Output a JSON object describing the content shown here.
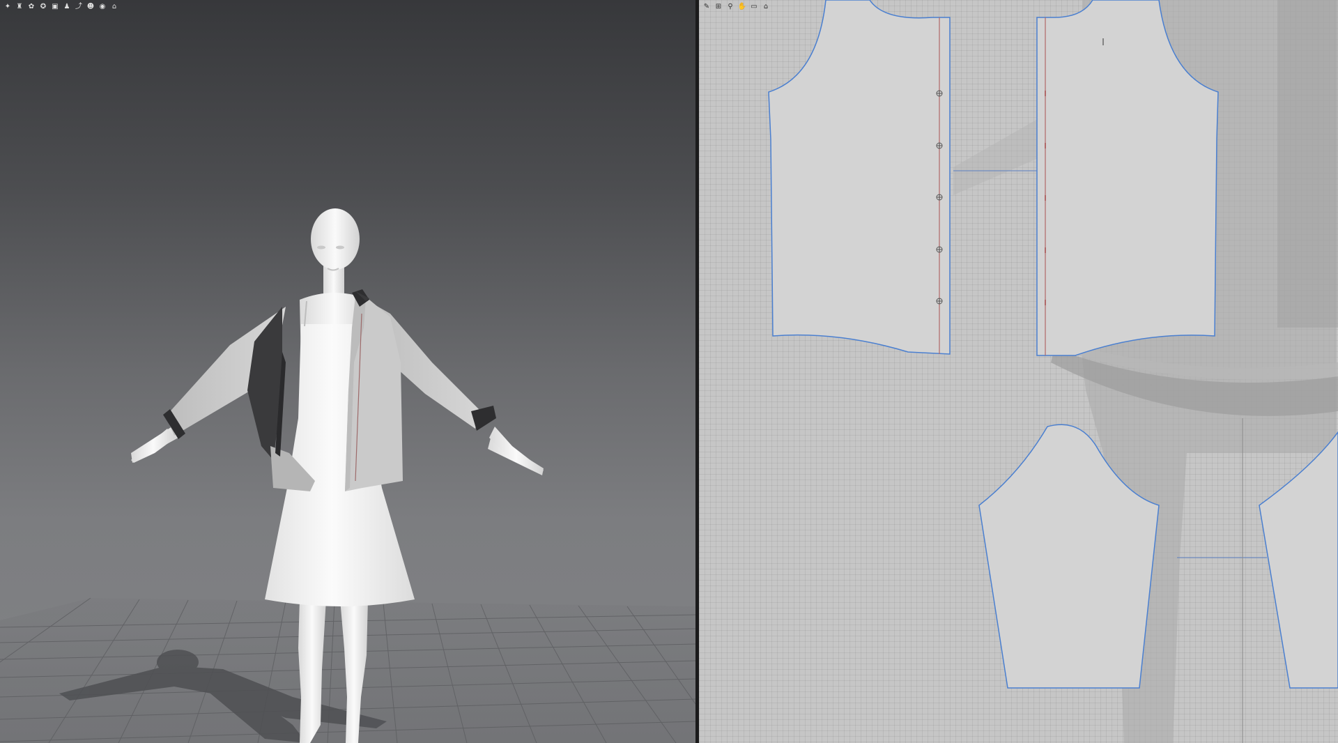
{
  "toolbar_3d": {
    "icons": [
      "simulation-icon",
      "garment-icon",
      "fabric-icon",
      "style-icon",
      "texture-icon",
      "avatar-icon",
      "pose-icon",
      "measure-icon",
      "render-icon"
    ]
  },
  "toolbar_2d": {
    "icons": [
      "edit-pattern-icon",
      "transform-icon",
      "zoom-icon",
      "hand-icon",
      "layer-icon",
      "render-icon"
    ]
  },
  "viewport_3d": {
    "background_top": "#37383b",
    "background_bottom": "#828386",
    "floor_grid": true,
    "avatar_pose": "A-pose",
    "garments": [
      "slip dress",
      "open shirt"
    ],
    "shirt_color": "#c9c9c9",
    "shirt_lining_color": "#3a3a3c",
    "dress_color": "#f4f4f4"
  },
  "viewport_2d": {
    "grid": true,
    "background": "#c6c6c6",
    "piece_fill": "#d3d3d3",
    "outline_color": "#4a7fd0",
    "seam_line_color": "#b06868",
    "pieces": [
      "front-left-bodice",
      "front-right-bodice",
      "left-sleeve",
      "right-sleeve"
    ],
    "button_count": 5
  }
}
